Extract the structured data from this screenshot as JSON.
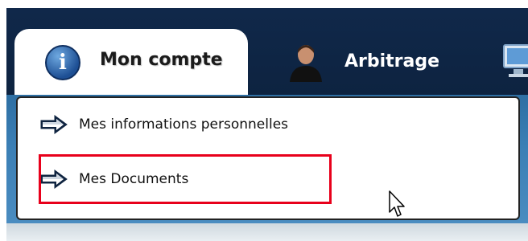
{
  "nav": {
    "tabs": [
      {
        "label": "Mon compte",
        "icon": "info-icon",
        "active": true
      },
      {
        "label": "Arbitrage",
        "icon": "person-icon",
        "active": false
      },
      {
        "label": "",
        "icon": "monitor-icon",
        "active": false
      }
    ]
  },
  "dropdown": {
    "items": [
      {
        "label": "Mes informations personnelles",
        "icon": "arrow-right-icon"
      },
      {
        "label": "Mes Documents",
        "icon": "arrow-right-icon",
        "highlighted": true
      }
    ]
  },
  "colors": {
    "navbar": "#10284a",
    "bluebar": "#3b7fb5",
    "highlight": "#e8001b"
  }
}
